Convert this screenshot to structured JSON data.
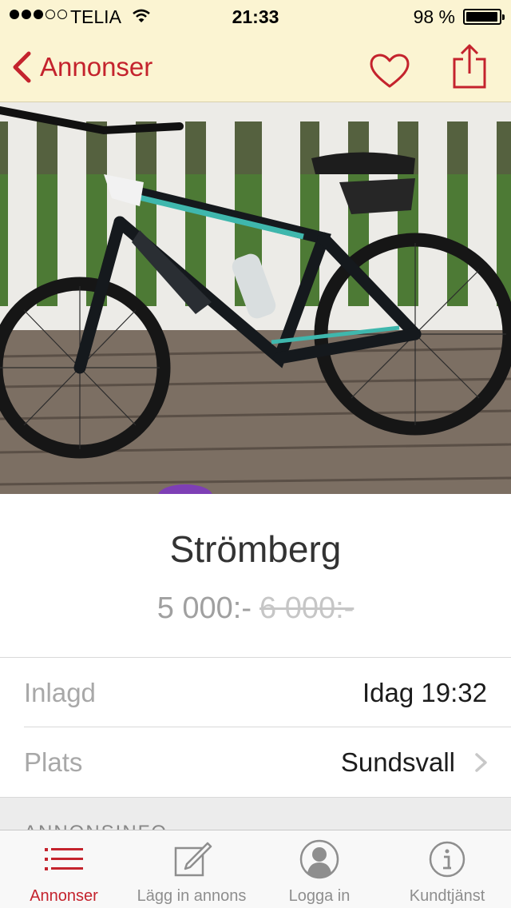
{
  "status_bar": {
    "carrier": "TELIA",
    "time": "21:33",
    "battery": "98 %",
    "battery_level": 0.98
  },
  "nav": {
    "back_label": "Annonser",
    "back_icon": "chevron-left-icon",
    "favorite_icon": "heart-icon",
    "share_icon": "share-icon"
  },
  "listing": {
    "title": "Strömberg",
    "price": "5 000:-",
    "old_price": "6 000:-"
  },
  "details": [
    {
      "label": "Inlagd",
      "value": "Idag 19:32"
    },
    {
      "label": "Plats",
      "value": "Sundsvall"
    }
  ],
  "section_header": "ANNONSINFO",
  "tabs": [
    {
      "label": "Annonser",
      "icon": "list-icon",
      "active": true
    },
    {
      "label": "Lägg in annons",
      "icon": "compose-icon",
      "active": false
    },
    {
      "label": "Logga in",
      "icon": "user-icon",
      "active": false
    },
    {
      "label": "Kundtjänst",
      "icon": "info-icon",
      "active": false
    }
  ],
  "colors": {
    "accent": "#c4232d",
    "bar_background": "#fbf4d2"
  }
}
